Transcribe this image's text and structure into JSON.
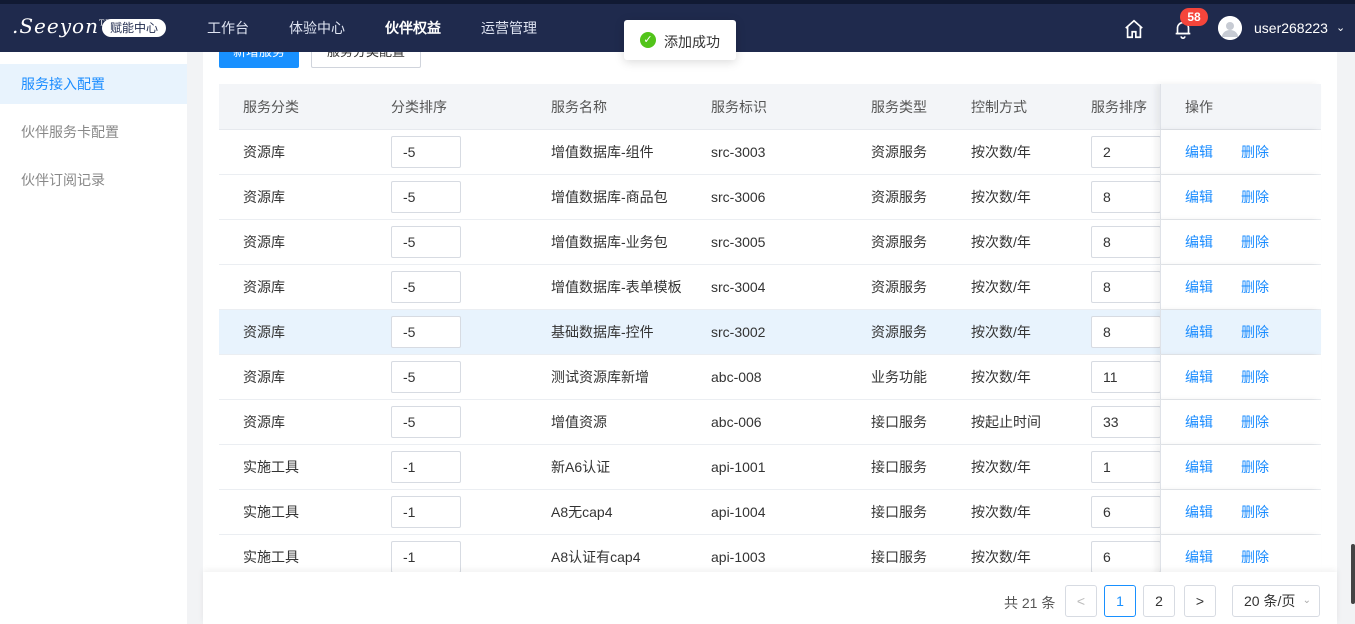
{
  "header": {
    "logo_text": ".Seeyon",
    "logo_tm": "TM",
    "brand_badge": "赋能中心",
    "nav": [
      "工作台",
      "体验中心",
      "伙伴权益",
      "运营管理"
    ],
    "active_nav": "伙伴权益",
    "notification_count": "58",
    "user_name": "user268223"
  },
  "sidebar": {
    "items": [
      "服务接入配置",
      "伙伴服务卡配置",
      "伙伴订阅记录"
    ],
    "active": "服务接入配置"
  },
  "toolbar": {
    "add_service_label": "新增服务",
    "category_config_label": "服务分类配置"
  },
  "toast": {
    "message": "添加成功"
  },
  "table": {
    "headers": [
      "服务分类",
      "分类排序",
      "服务名称",
      "服务标识",
      "服务类型",
      "控制方式",
      "服务排序",
      "操作"
    ],
    "edit_label": "编辑",
    "delete_label": "删除",
    "rows": [
      {
        "category": "资源库",
        "cat_order": "-5",
        "name": "增值数据库-组件",
        "id": "src-3003",
        "type": "资源服务",
        "control": "按次数/年",
        "order": "2"
      },
      {
        "category": "资源库",
        "cat_order": "-5",
        "name": "增值数据库-商品包",
        "id": "src-3006",
        "type": "资源服务",
        "control": "按次数/年",
        "order": "8"
      },
      {
        "category": "资源库",
        "cat_order": "-5",
        "name": "增值数据库-业务包",
        "id": "src-3005",
        "type": "资源服务",
        "control": "按次数/年",
        "order": "8"
      },
      {
        "category": "资源库",
        "cat_order": "-5",
        "name": "增值数据库-表单模板",
        "id": "src-3004",
        "type": "资源服务",
        "control": "按次数/年",
        "order": "8"
      },
      {
        "category": "资源库",
        "cat_order": "-5",
        "name": "基础数据库-控件",
        "id": "src-3002",
        "type": "资源服务",
        "control": "按次数/年",
        "order": "8"
      },
      {
        "category": "资源库",
        "cat_order": "-5",
        "name": "测试资源库新增",
        "id": "abc-008",
        "type": "业务功能",
        "control": "按次数/年",
        "order": "11"
      },
      {
        "category": "资源库",
        "cat_order": "-5",
        "name": "增值资源",
        "id": "abc-006",
        "type": "接口服务",
        "control": "按起止时间",
        "order": "33"
      },
      {
        "category": "实施工具",
        "cat_order": "-1",
        "name": "新A6认证",
        "id": "api-1001",
        "type": "接口服务",
        "control": "按次数/年",
        "order": "1"
      },
      {
        "category": "实施工具",
        "cat_order": "-1",
        "name": "A8无cap4",
        "id": "api-1004",
        "type": "接口服务",
        "control": "按次数/年",
        "order": "6"
      },
      {
        "category": "实施工具",
        "cat_order": "-1",
        "name": "A8认证有cap4",
        "id": "api-1003",
        "type": "接口服务",
        "control": "按次数/年",
        "order": "6"
      }
    ]
  },
  "pagination": {
    "total_text": "共 21 条",
    "prev": "<",
    "next": ">",
    "pages": [
      "1",
      "2"
    ],
    "current_page": "1",
    "page_size": "20 条/页"
  }
}
